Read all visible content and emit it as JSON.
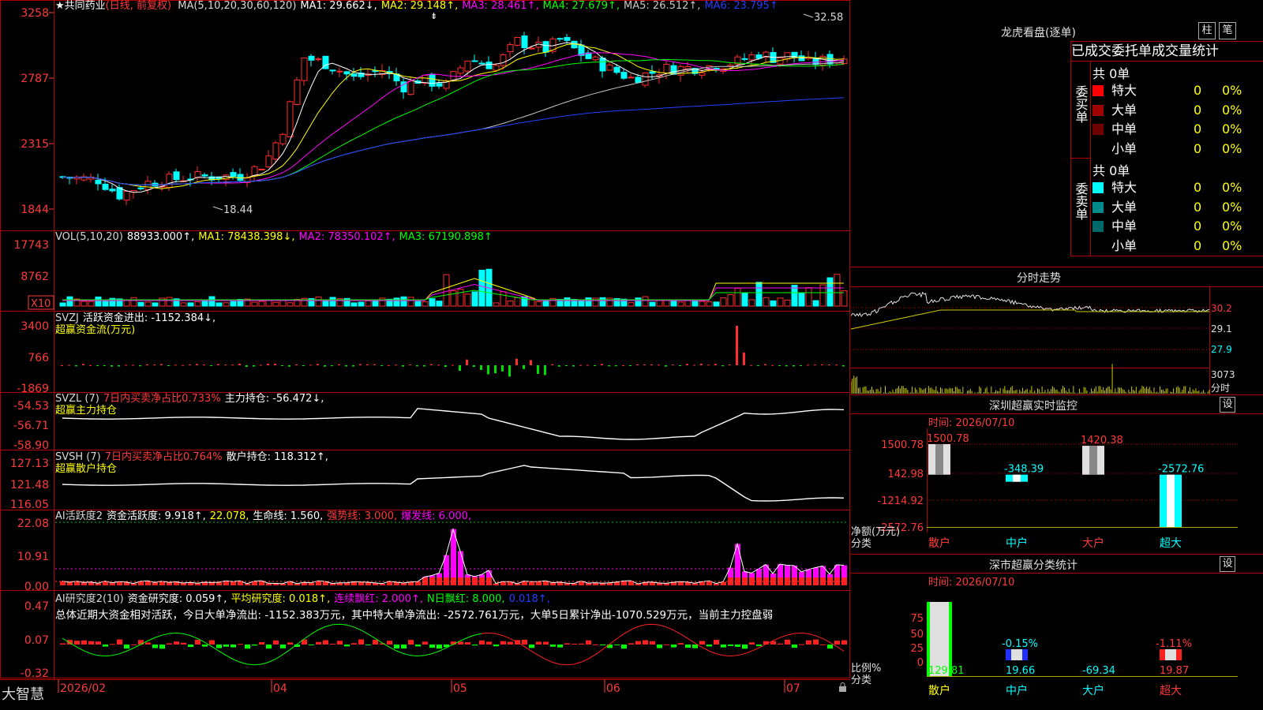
{
  "stock": {
    "star": "★",
    "name": "共同药业",
    "mode": "(日线, 前复权)"
  },
  "colors": {
    "up": "#ff2d2d",
    "down": "#00ffff",
    "grid": "#a00000",
    "label": "#ff3a3a",
    "text": "#d8d8d8",
    "yellow": "#ffff00",
    "magenta": "#ff00ff",
    "green": "#00e000"
  },
  "panels": {
    "price": {
      "header": [
        {
          "t": "MA(5,10,20,30,60,120)",
          "c": "#d8d8d8"
        },
        {
          "t": "MA1: 29.662↓,",
          "c": "#ffffff"
        },
        {
          "t": "MA2: 29.148↑,",
          "c": "#ffff00"
        },
        {
          "t": "MA3: 28.461↑,",
          "c": "#ff00ff"
        },
        {
          "t": "MA4: 27.679↑,",
          "c": "#00ff00"
        },
        {
          "t": "MA5: 26.512↑,",
          "c": "#c8c8c8"
        },
        {
          "t": "MA6: 23.795↑",
          "c": "#2040ff"
        }
      ],
      "yticks": [
        "3258",
        "2787",
        "2315",
        "1844"
      ],
      "high_label": "32.58",
      "low_label": "18.44"
    },
    "volume": {
      "header": [
        {
          "t": "VOL(5,10,20)",
          "c": "#d8d8d8"
        },
        {
          "t": "88933.000↑,",
          "c": "#ffffff"
        },
        {
          "t": "MA1: 78438.398↓,",
          "c": "#ffff00"
        },
        {
          "t": "MA2: 78350.102↑,",
          "c": "#ff00ff"
        },
        {
          "t": "MA3: 67190.898↑",
          "c": "#00ff00"
        }
      ],
      "yticks": [
        "17743",
        "8762"
      ],
      "unit": "X10"
    },
    "svzj": {
      "header": [
        {
          "t": "SVZJ",
          "c": "#d8d8d8"
        },
        {
          "t": "活跃资金进出: -1152.384↓,",
          "c": "#ffffff"
        }
      ],
      "subtitle": "超赢资金流(万元)",
      "yticks": [
        "3400",
        "766",
        "-1869"
      ]
    },
    "svzl": {
      "header": [
        {
          "t": "SVZL (7)",
          "c": "#d8d8d8"
        },
        {
          "t": "7日内买卖净占比0.733%",
          "c": "#ff3a3a"
        },
        {
          "t": "主力持仓: -56.472↓,",
          "c": "#ffffff"
        }
      ],
      "subtitle": "超赢主力持仓",
      "yticks": [
        "-54.53",
        "-56.71",
        "-58.90"
      ]
    },
    "svsh": {
      "header": [
        {
          "t": "SVSH (7)",
          "c": "#d8d8d8"
        },
        {
          "t": "7日内买卖净占比0.764%",
          "c": "#ff3a3a"
        },
        {
          "t": "散户持仓: 118.312↑,",
          "c": "#ffffff"
        }
      ],
      "subtitle": "超赢散户持仓",
      "yticks": [
        "127.13",
        "121.48",
        "116.05"
      ]
    },
    "ai_active": {
      "header": [
        {
          "t": "AI活跃度2",
          "c": "#d8d8d8"
        },
        {
          "t": "资金活跃度: 9.918↑,",
          "c": "#ffffff"
        },
        {
          "t": "22.078,",
          "c": "#ffff00"
        },
        {
          "t": "生命线: 1.560,",
          "c": "#ffffff"
        },
        {
          "t": "强势线: 3.000,",
          "c": "#ff3a3a"
        },
        {
          "t": "爆发线: 6.000,",
          "c": "#ff00ff"
        }
      ],
      "yticks": [
        "22.08",
        "10.91",
        "0.00"
      ]
    },
    "ai_research": {
      "header": [
        {
          "t": "AI研究度2(10)",
          "c": "#d8d8d8"
        },
        {
          "t": "资金研究度: 0.059↑,",
          "c": "#ffffff"
        },
        {
          "t": "平均研究度: 0.018↑,",
          "c": "#ffff00"
        },
        {
          "t": "连续飘红: 2.000↑,",
          "c": "#ff00ff"
        },
        {
          "t": "N日飘红: 8.000,",
          "c": "#00ff00"
        },
        {
          "t": "0.018↑,",
          "c": "#2040ff"
        }
      ],
      "summary": "总体近期大资金相对活跃，今日大单净流出: -1152.383万元，其中特大单净流出: -2572.761万元，大单5日累计净出-1070.529万元，当前主力控盘弱",
      "yticks": [
        "0.47",
        "0.07",
        "-0.32"
      ]
    }
  },
  "date_axis": [
    "2026/02",
    "04",
    "05",
    "06",
    "07"
  ],
  "brand": "大智慧",
  "longhu": {
    "title": "龙虎看盘(逐单)",
    "btn_bar": "柱",
    "btn_pen": "笔",
    "tabs": [
      "已成交",
      "委托单",
      "成交量统计"
    ],
    "buy": {
      "group": "委买单",
      "count": "共 0单",
      "rows": [
        {
          "label": "特大",
          "n": "0",
          "pct": "0%",
          "color": "#ff0000"
        },
        {
          "label": "大单",
          "n": "0",
          "pct": "0%",
          "color": "#a00000"
        },
        {
          "label": "中单",
          "n": "0",
          "pct": "0%",
          "color": "#700000"
        },
        {
          "label": "小单",
          "n": "0",
          "pct": "0%",
          "color": ""
        }
      ]
    },
    "sell": {
      "group": "委卖单",
      "count": "共 0单",
      "rows": [
        {
          "label": "特大",
          "n": "0",
          "pct": "0%",
          "color": "#00ffff"
        },
        {
          "label": "大单",
          "n": "0",
          "pct": "0%",
          "color": "#008a8a"
        },
        {
          "label": "中单",
          "n": "0",
          "pct": "0%",
          "color": "#006a6a"
        },
        {
          "label": "小单",
          "n": "0",
          "pct": "0%",
          "color": ""
        }
      ]
    }
  },
  "intraday": {
    "title": "分时走势",
    "yticks": [
      "30.2",
      "29.1",
      "27.9",
      "3073"
    ],
    "volume_label": "分时"
  },
  "monitor": {
    "title": "深圳超赢实时监控",
    "set": "设",
    "time": "时间: 2026/07/10",
    "yticks": [
      "1500.78",
      "142.98",
      "-1214.92",
      "-2572.76"
    ],
    "ylabel_1": "净额(万元)",
    "ylabel_2": "分类",
    "categories": [
      "散户",
      "中户",
      "大户",
      "超大"
    ],
    "values": [
      "1500.78",
      "-348.39",
      "1420.38",
      "-2572.76"
    ]
  },
  "classify": {
    "title": "深市超赢分类统计",
    "set": "设",
    "time": "时间: 2026/07/10",
    "yticks": [
      "75",
      "50",
      "25",
      "0"
    ],
    "ylabel_1": "比例%",
    "ylabel_2": "分类",
    "categories": [
      "散户",
      "中户",
      "大户",
      "超大"
    ],
    "pct_labels": [
      "",
      "-0.15%",
      "",
      "-1.11%"
    ],
    "values": [
      "129.81",
      "19.66",
      "-69.34",
      "19.87"
    ]
  },
  "chart_data": [
    {
      "type": "bar",
      "title": "深圳超赢实时监控",
      "ylabel": "净额(万元)",
      "categories": [
        "散户",
        "中户",
        "大户",
        "超大"
      ],
      "values": [
        1500.78,
        -348.39,
        1420.38,
        -2572.76
      ],
      "ylim": [
        -2572.76,
        1500.78
      ]
    },
    {
      "type": "bar",
      "title": "深市超赢分类统计",
      "ylabel": "比例%",
      "categories": [
        "散户",
        "中户",
        "大户",
        "超大"
      ],
      "values": [
        129.81,
        19.66,
        -69.34,
        19.87
      ],
      "ylim": [
        0,
        75
      ]
    }
  ]
}
